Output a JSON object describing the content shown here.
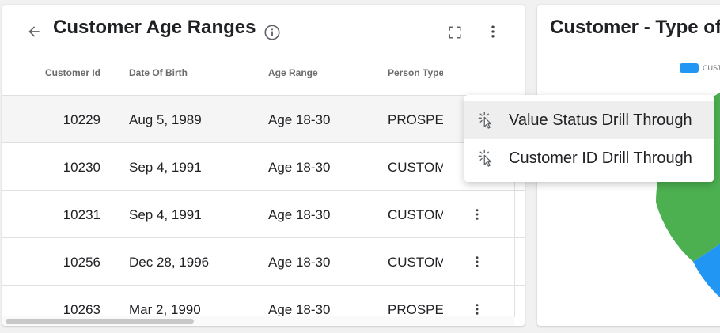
{
  "left_panel": {
    "title": "Customer Age Ranges",
    "columns": [
      "Customer Id",
      "Date Of Birth",
      "Age Range",
      "Person Type"
    ],
    "rows": [
      {
        "id": "10229",
        "dob": "Aug 5, 1989",
        "age": "Age 18-30",
        "type": "PROSPEC"
      },
      {
        "id": "10230",
        "dob": "Sep 4, 1991",
        "age": "Age 18-30",
        "type": "CUSTOM"
      },
      {
        "id": "10231",
        "dob": "Sep 4, 1991",
        "age": "Age 18-30",
        "type": "CUSTOM"
      },
      {
        "id": "10256",
        "dob": "Dec 28, 1996",
        "age": "Age 18-30",
        "type": "CUSTOM"
      },
      {
        "id": "10263",
        "dob": "Mar 2, 1990",
        "age": "Age 18-30",
        "type": "PROSPEC"
      }
    ],
    "icons": [
      "back-arrow-icon",
      "info-icon",
      "fullscreen-icon",
      "more-vert-icon"
    ]
  },
  "context_menu": {
    "items": [
      {
        "label": "Value Status Drill Through",
        "icon": "drill-cursor-icon"
      },
      {
        "label": "Customer ID Drill Through",
        "icon": "drill-cursor-icon"
      }
    ]
  },
  "right_panel": {
    "title": "Customer - Type of",
    "legend_label": "CUST",
    "colors": {
      "green": "#4caf50",
      "blue": "#2196f3"
    }
  }
}
